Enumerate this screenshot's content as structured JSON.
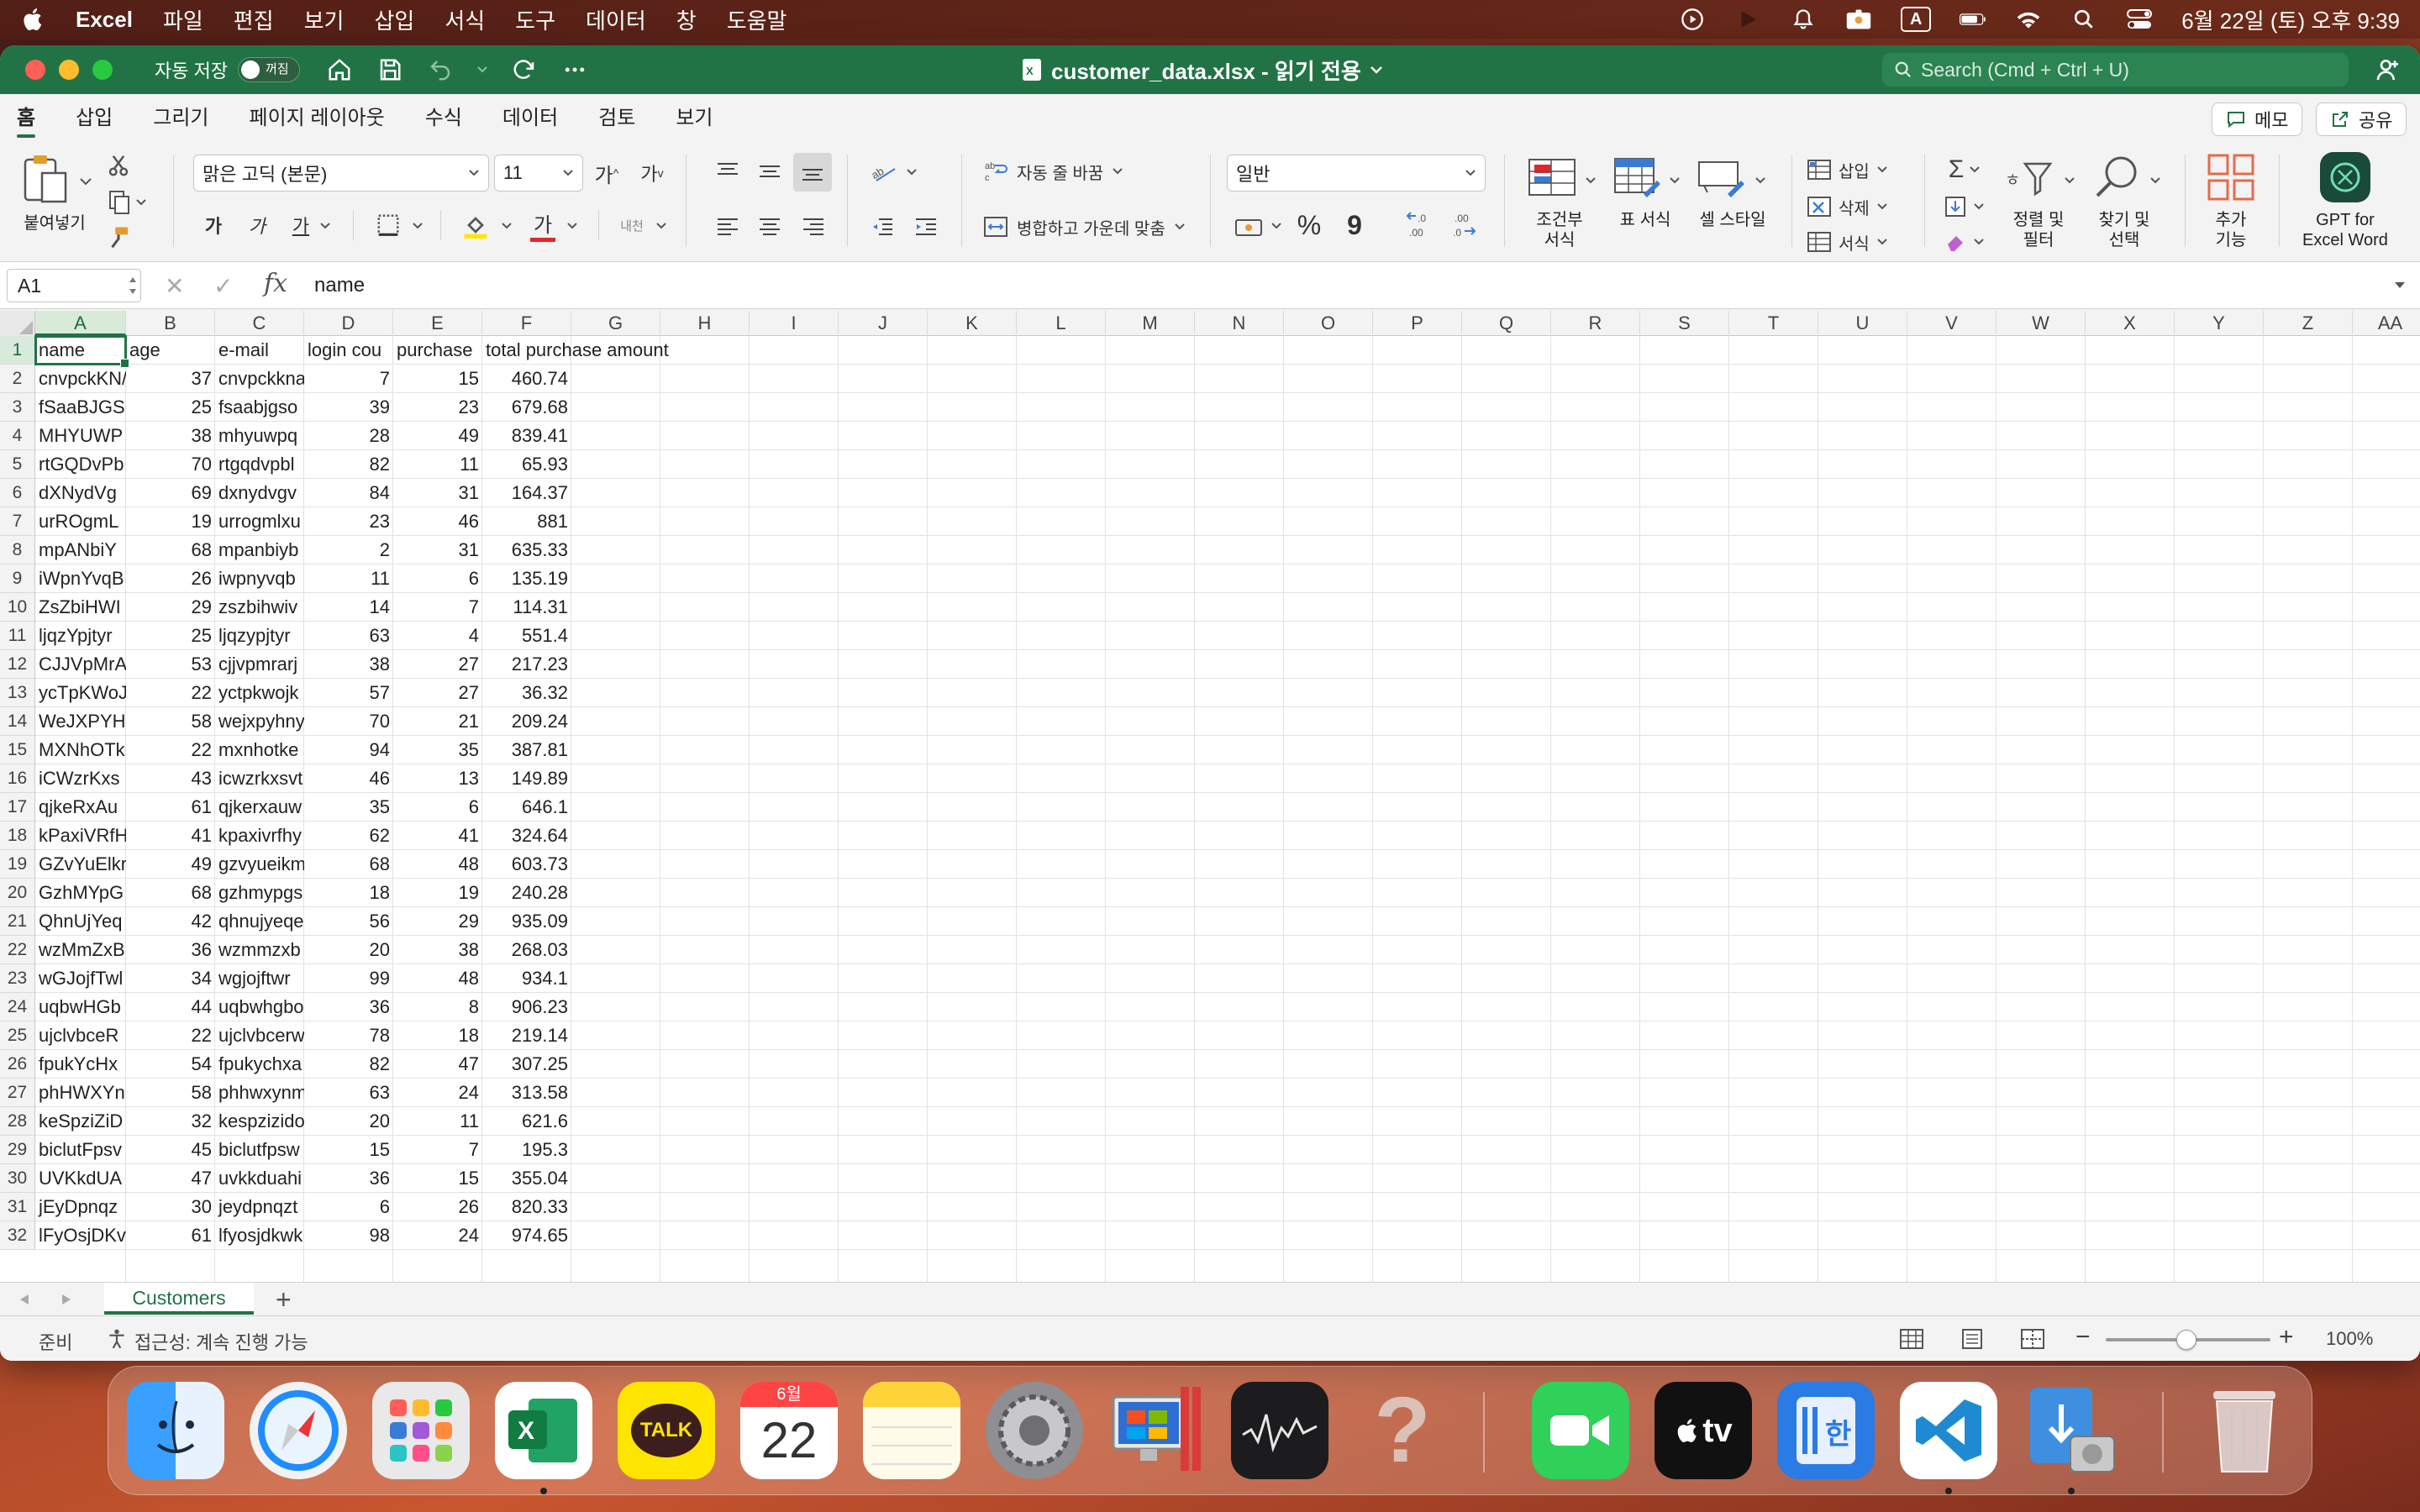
{
  "menubar": {
    "app_name": "Excel",
    "items": [
      "파일",
      "편집",
      "보기",
      "삽입",
      "서식",
      "도구",
      "데이터",
      "창",
      "도움말"
    ],
    "clock": "6월 22일 (토) 오후 9:39",
    "input_indicator": "A"
  },
  "titlebar": {
    "autosave_label": "자동 저장",
    "autosave_state": "꺼짐",
    "doc_title": "customer_data.xlsx  -  읽기 전용",
    "search_placeholder": "Search (Cmd + Ctrl + U)"
  },
  "ribbon_tabs": {
    "tabs": [
      "홈",
      "삽입",
      "그리기",
      "페이지 레이아웃",
      "수식",
      "데이터",
      "검토",
      "보기"
    ],
    "active": "홈",
    "memo_label": "메모",
    "share_label": "공유"
  },
  "ribbon": {
    "paste_label": "붙여넣기",
    "font_name": "맑은 고딕 (본문)",
    "font_size": "11",
    "grow_font": "가",
    "shrink_font": "가",
    "bold": "가",
    "italic": "가",
    "underline": "가",
    "font_color_glyph": "가",
    "phonetic": "내천",
    "wrap_text": "자동 줄 바꿈",
    "merge_center": "병합하고 가운데 맞춤",
    "number_format": "일반",
    "percent": "%",
    "comma": "9",
    "conditional_format": "조건부\n서식",
    "format_table": "표 서식",
    "cell_style": "셀 스타일",
    "insert": "삽입",
    "delete": "삭제",
    "format": "서식",
    "sort_filter": "정렬 및\n필터",
    "find_select": "찾기 및\n선택",
    "addins": "추가\n기능",
    "gpt": "GPT for\nExcel Word"
  },
  "formula_bar": {
    "name_box": "A1",
    "fx": "fx",
    "formula": "name"
  },
  "columns": [
    "A",
    "B",
    "C",
    "D",
    "E",
    "F",
    "G",
    "H",
    "I",
    "J",
    "K",
    "L",
    "M",
    "N",
    "O",
    "P",
    "Q",
    "R",
    "S",
    "T",
    "U",
    "V",
    "W",
    "X",
    "Y",
    "Z",
    "AA"
  ],
  "header_row": [
    "name",
    "age",
    "e-mail",
    "login cou",
    "purchase",
    "total purchase amount"
  ],
  "rows": [
    [
      "cnvpckKN/",
      "37",
      "cnvpckkna",
      "7",
      "15",
      "460.74"
    ],
    [
      "fSaaBJGSC",
      "25",
      "fsaabjgso",
      "39",
      "23",
      "679.68"
    ],
    [
      "MHYUWP",
      "38",
      "mhyuwpq",
      "28",
      "49",
      "839.41"
    ],
    [
      "rtGQDvPb",
      "70",
      "rtgqdvpbl",
      "82",
      "11",
      "65.93"
    ],
    [
      "dXNydVg",
      "69",
      "dxnydvgv",
      "84",
      "31",
      "164.37"
    ],
    [
      "urROgmL",
      "19",
      "urrogmlxu",
      "23",
      "46",
      "881"
    ],
    [
      "mpANbiY",
      "68",
      "mpanbiyb",
      "2",
      "31",
      "635.33"
    ],
    [
      "iWpnYvqB",
      "26",
      "iwpnyvqb",
      "11",
      "6",
      "135.19"
    ],
    [
      "ZsZbiHWI",
      "29",
      "zszbihwiv",
      "14",
      "7",
      "114.31"
    ],
    [
      "ljqzYpjtyr",
      "25",
      "ljqzypjtyr",
      "63",
      "4",
      "551.4"
    ],
    [
      "CJJVpMrA",
      "53",
      "cjjvpmrarj",
      "38",
      "27",
      "217.23"
    ],
    [
      "ycTpKWoJ",
      "22",
      "yctpkwojk",
      "57",
      "27",
      "36.32"
    ],
    [
      "WeJXPYH",
      "58",
      "wejxpyhny",
      "70",
      "21",
      "209.24"
    ],
    [
      "MXNhOTk",
      "22",
      "mxnhotke",
      "94",
      "35",
      "387.81"
    ],
    [
      "iCWzrKxs",
      "43",
      "icwzrkxsvt",
      "46",
      "13",
      "149.89"
    ],
    [
      "qjkeRxAu",
      "61",
      "qjkerxauw",
      "35",
      "6",
      "646.1"
    ],
    [
      "kPaxiVRfH",
      "41",
      "kpaxivrfhy",
      "62",
      "41",
      "324.64"
    ],
    [
      "GZvYuElkr",
      "49",
      "gzvyueikm",
      "68",
      "48",
      "603.73"
    ],
    [
      "GzhMYpG",
      "68",
      "gzhmypgs",
      "18",
      "19",
      "240.28"
    ],
    [
      "QhnUjYeq",
      "42",
      "qhnujyeqe",
      "56",
      "29",
      "935.09"
    ],
    [
      "wzMmZxB",
      "36",
      "wzmmzxb",
      "20",
      "38",
      "268.03"
    ],
    [
      "wGJojfTwl",
      "34",
      "wgjojftwr",
      "99",
      "48",
      "934.1"
    ],
    [
      "uqbwHGb",
      "44",
      "uqbwhgbo",
      "36",
      "8",
      "906.23"
    ],
    [
      "ujclvbceR",
      "22",
      "ujclvbcerw",
      "78",
      "18",
      "219.14"
    ],
    [
      "fpukYcHx",
      "54",
      "fpukychxa",
      "82",
      "47",
      "307.25"
    ],
    [
      "phHWXYn",
      "58",
      "phhwxynm",
      "63",
      "24",
      "313.58"
    ],
    [
      "keSpziZiD",
      "32",
      "kespzizido",
      "20",
      "11",
      "621.6"
    ],
    [
      "biclutFpsv",
      "45",
      "biclutfpsw",
      "15",
      "7",
      "195.3"
    ],
    [
      "UVKkdUA",
      "47",
      "uvkkduahi",
      "36",
      "15",
      "355.04"
    ],
    [
      "jEyDpnqz",
      "30",
      "jeydpnqzt",
      "6",
      "26",
      "820.33"
    ],
    [
      "lFyOsjDKv",
      "61",
      "lfyosjdkwk",
      "98",
      "24",
      "974.65"
    ]
  ],
  "sheet": {
    "tabs": [
      "Customers"
    ],
    "add_label": "+"
  },
  "status_bar": {
    "ready": "준비",
    "accessibility": "접근성: 계속 진행 가능",
    "zoom": "100%"
  },
  "dock": {
    "apps": [
      "finder-icon",
      "safari-icon",
      "launchpad-icon",
      "excel-icon",
      "kakaotalk-icon",
      "calendar-icon",
      "notes-icon",
      "system-settings-icon",
      "parallels-icon",
      "stocks-icon",
      "help-icon",
      "facetime-icon",
      "apple-tv-icon",
      "hangul-viewer-icon",
      "vscode-icon",
      "archive-utility-icon",
      "trash-icon"
    ],
    "calendar_month": "6월",
    "calendar_day": "22",
    "kakao_label": "TALK",
    "tv_label": "tv"
  },
  "colors": {
    "excel_green": "#217346",
    "selection_green": "#d8ead9"
  }
}
